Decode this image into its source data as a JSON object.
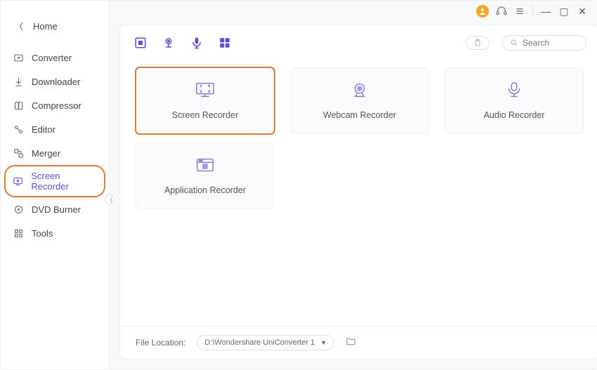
{
  "title": "Home",
  "sidebar": {
    "items": [
      {
        "label": "Converter"
      },
      {
        "label": "Downloader"
      },
      {
        "label": "Compressor"
      },
      {
        "label": "Editor"
      },
      {
        "label": "Merger"
      },
      {
        "label": "Screen Recorder"
      },
      {
        "label": "DVD Burner"
      },
      {
        "label": "Tools"
      }
    ]
  },
  "cards": [
    {
      "label": "Screen Recorder"
    },
    {
      "label": "Webcam Recorder"
    },
    {
      "label": "Audio Recorder"
    },
    {
      "label": "Application Recorder"
    }
  ],
  "search": {
    "placeholder": "Search"
  },
  "footer": {
    "label": "File Location:",
    "path": "D:\\Wondershare UniConverter 1"
  }
}
